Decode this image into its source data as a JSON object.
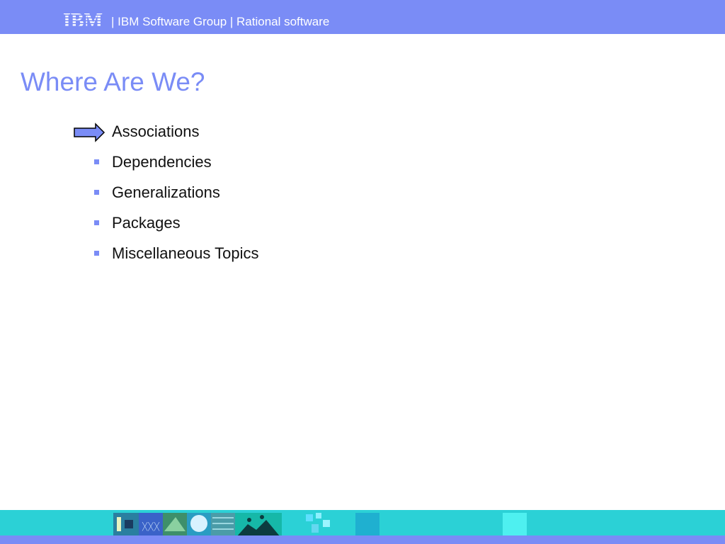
{
  "header": {
    "brand": "IBM",
    "text": "| IBM Software Group | Rational software"
  },
  "slide": {
    "title": "Where Are We?",
    "agenda": [
      {
        "label": "Associations",
        "current": true
      },
      {
        "label": "Dependencies",
        "current": false
      },
      {
        "label": "Generalizations",
        "current": false
      },
      {
        "label": "Packages",
        "current": false
      },
      {
        "label": "Miscellaneous Topics",
        "current": false
      }
    ]
  },
  "colors": {
    "accent": "#7a8cf6",
    "footer_band": "#2bd1d6",
    "text": "#111111"
  },
  "icons": {
    "logo": "ibm-striped-logo",
    "current_marker": "right-arrow-icon",
    "bullet": "square-bullet-icon"
  }
}
